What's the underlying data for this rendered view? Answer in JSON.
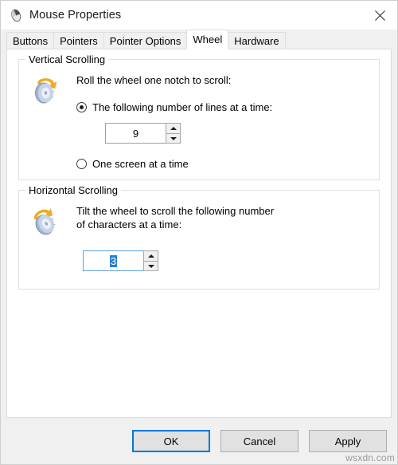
{
  "window": {
    "title": "Mouse Properties",
    "title_icon": "mouse-icon",
    "close_label": "✕"
  },
  "tabs": [
    {
      "label": "Buttons",
      "selected": false
    },
    {
      "label": "Pointers",
      "selected": false
    },
    {
      "label": "Pointer Options",
      "selected": false
    },
    {
      "label": "Wheel",
      "selected": true
    },
    {
      "label": "Hardware",
      "selected": false
    }
  ],
  "vertical_scrolling": {
    "group_title": "Vertical Scrolling",
    "icon": "mouse-wheel-vertical-icon",
    "lead_text": "Roll the wheel one notch to scroll:",
    "options": [
      {
        "label": "The following number of lines at a time:",
        "checked": true
      },
      {
        "label": "One screen at a time",
        "checked": false
      }
    ],
    "spinner": {
      "value": "9",
      "focused": false,
      "selected": false,
      "up_label": "▲",
      "down_label": "▼"
    }
  },
  "horizontal_scrolling": {
    "group_title": "Horizontal Scrolling",
    "icon": "mouse-wheel-horizontal-icon",
    "lead_text_line1": "Tilt the wheel to scroll the following number",
    "lead_text_line2": "of characters at a time:",
    "spinner": {
      "value": "3",
      "focused": true,
      "selected": true,
      "up_label": "▲",
      "down_label": "▼"
    }
  },
  "footer": {
    "ok_label": "OK",
    "cancel_label": "Cancel",
    "apply_label": "Apply"
  },
  "watermark": "wsxdn.com",
  "colors": {
    "accent": "#0078d7",
    "selection": "#2a7fd4",
    "focus_border": "#5aa0d8",
    "window_bg": "#f0f0f0",
    "panel_bg": "#ffffff",
    "group_border": "#dfdfdf"
  }
}
